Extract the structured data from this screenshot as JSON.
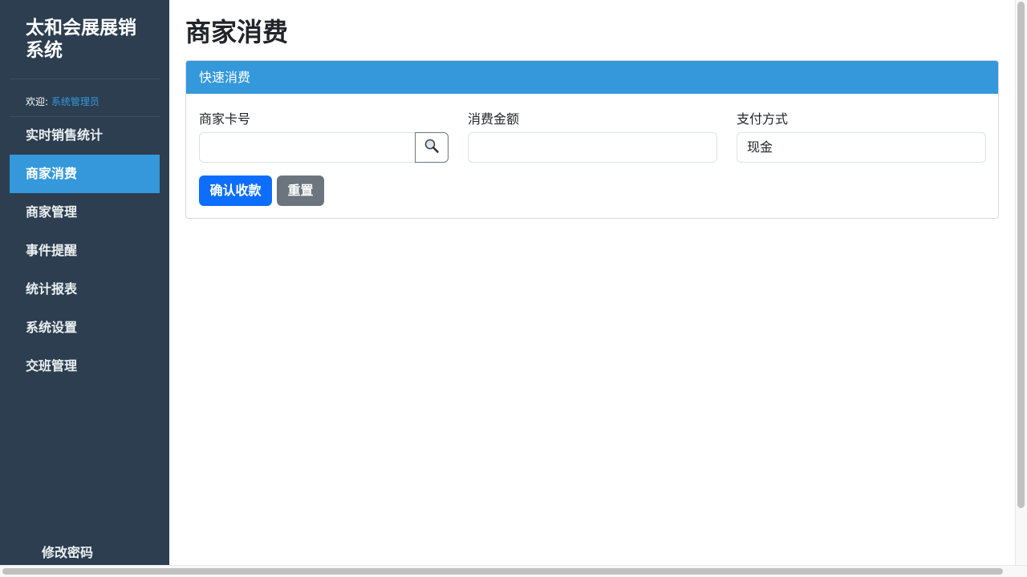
{
  "sidebar": {
    "brand": "太和会展展销系统",
    "welcome_prefix": "欢迎: ",
    "user_name": "系统管理员",
    "items": [
      {
        "label": "实时销售统计"
      },
      {
        "label": "商家消费"
      },
      {
        "label": "商家管理"
      },
      {
        "label": "事件提醒"
      },
      {
        "label": "统计报表"
      },
      {
        "label": "系统设置"
      },
      {
        "label": "交班管理"
      }
    ],
    "active_index": 1,
    "change_password": "修改密码"
  },
  "main": {
    "page_title": "商家消费",
    "card": {
      "header": "快速消费",
      "fields": {
        "card_no": {
          "label": "商家卡号",
          "value": ""
        },
        "amount": {
          "label": "消费金额",
          "value": ""
        },
        "payment": {
          "label": "支付方式",
          "value": "现金"
        }
      },
      "confirm_label": "确认收款",
      "reset_label": "重置"
    }
  },
  "colors": {
    "sidebar_bg": "#2c3e50",
    "accent": "#3498db",
    "primary_button": "#0d6efd",
    "secondary_button": "#6c757d"
  },
  "icons": {
    "search": "search-icon"
  }
}
